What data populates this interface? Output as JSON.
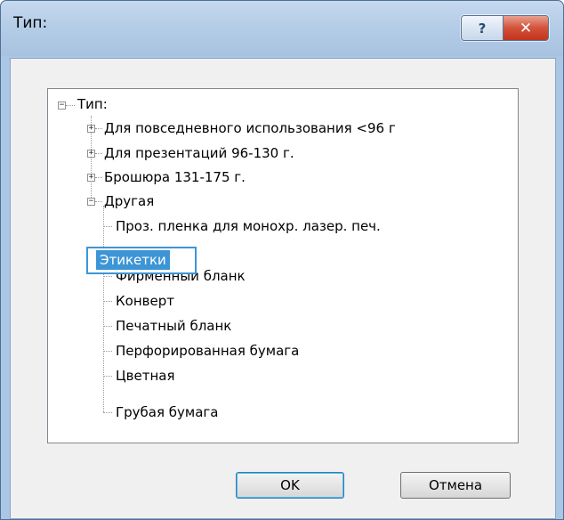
{
  "window": {
    "title": "Тип:",
    "help_glyph": "?",
    "close_glyph": "✕"
  },
  "tree": {
    "root_label": "Тип:",
    "items": [
      {
        "label": "Для повседневного использования <96 г",
        "expander": "+"
      },
      {
        "label": "Для презентаций 96-130 г.",
        "expander": "+"
      },
      {
        "label": "Брошюра 131-175 г.",
        "expander": "+"
      },
      {
        "label": "Другая",
        "expander": "−"
      }
    ],
    "root_expander": "−",
    "other_children": [
      "Проз. пленка для монохр. лазер. печ.",
      "Этикетки",
      "Фирменный бланк",
      "Конверт",
      "Печатный бланк",
      "Перфорированная бумага",
      "Цветная",
      "Грубая бумага"
    ],
    "selected": "Этикетки"
  },
  "buttons": {
    "ok": "OK",
    "cancel": "Отмена"
  }
}
